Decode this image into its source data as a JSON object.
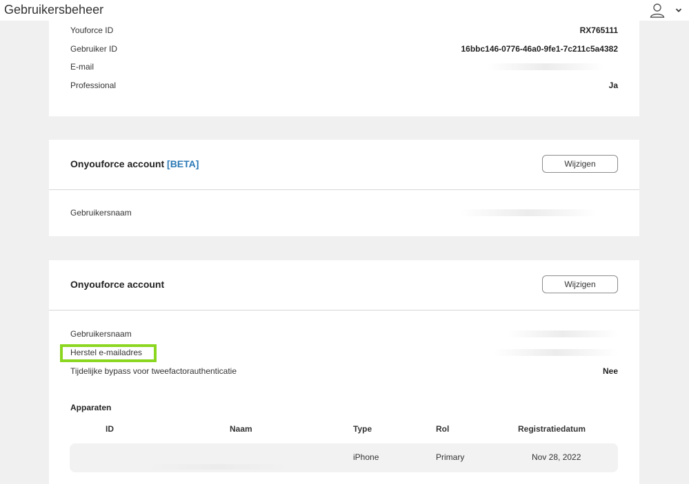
{
  "header": {
    "title": "Gebruikersbeheer",
    "user_icon": "user-icon",
    "menu_icon": "chevron-down-icon"
  },
  "profile": {
    "rows": [
      {
        "label": "Youforce ID",
        "value": "RX765111"
      },
      {
        "label": "Gebruiker ID",
        "value": "16bbc146-0776-46a0-9fe1-7c211c5a4382"
      },
      {
        "label": "E-mail",
        "value": ""
      },
      {
        "label": "Professional",
        "value": "Ja"
      }
    ]
  },
  "onyouforce_beta": {
    "title": "Onyouforce account",
    "badge": "[BETA]",
    "edit_label": "Wijzigen",
    "rows": [
      {
        "label": "Gebruikersnaam",
        "value": ""
      }
    ]
  },
  "onyouforce": {
    "title": "Onyouforce account",
    "edit_label": "Wijzigen",
    "rows": [
      {
        "label": "Gebruikersnaam",
        "value": ""
      },
      {
        "label": "Herstel e-mailadres",
        "value": ""
      },
      {
        "label": "Tijdelijke bypass voor tweefactorauthenticatie",
        "value": "Nee"
      }
    ],
    "devices": {
      "title": "Apparaten",
      "columns": [
        "ID",
        "Naam",
        "Type",
        "Rol",
        "Registratiedatum"
      ],
      "rows": [
        {
          "id": "",
          "name": "",
          "type": "iPhone",
          "role": "Primary",
          "date": "Nov 28, 2022"
        }
      ]
    }
  },
  "colors": {
    "accent": "#2a78b5",
    "highlight": "#8bd61f"
  }
}
